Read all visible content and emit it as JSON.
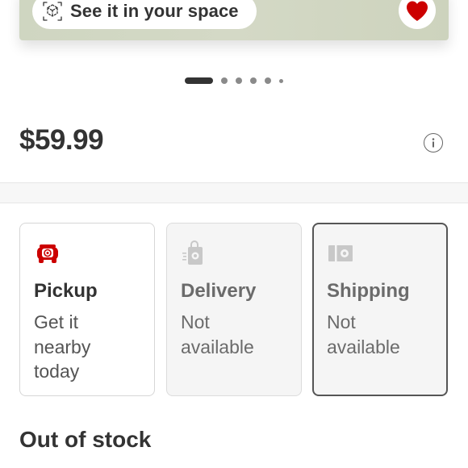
{
  "hero": {
    "ar_button_label": "See it in your space",
    "ar_icon": "ar-cube-icon",
    "favorite_icon": "heart-icon",
    "favorite_color": "#cc0000"
  },
  "carousel": {
    "total": 6,
    "active": 1
  },
  "price": "$59.99",
  "info_icon": "info-icon",
  "fulfillment": [
    {
      "key": "pickup",
      "icon": "pickup-icon",
      "title": "Pickup",
      "description": "Get it nearby today",
      "available": true,
      "selected": false
    },
    {
      "key": "delivery",
      "icon": "delivery-icon",
      "title": "Delivery",
      "description": "Not available",
      "available": false,
      "selected": false
    },
    {
      "key": "shipping",
      "icon": "shipping-icon",
      "title": "Shipping",
      "description": "Not available",
      "available": false,
      "selected": true
    }
  ],
  "stock_status": "Out of stock",
  "colors": {
    "brand_red": "#cc0000",
    "text": "#333333"
  }
}
